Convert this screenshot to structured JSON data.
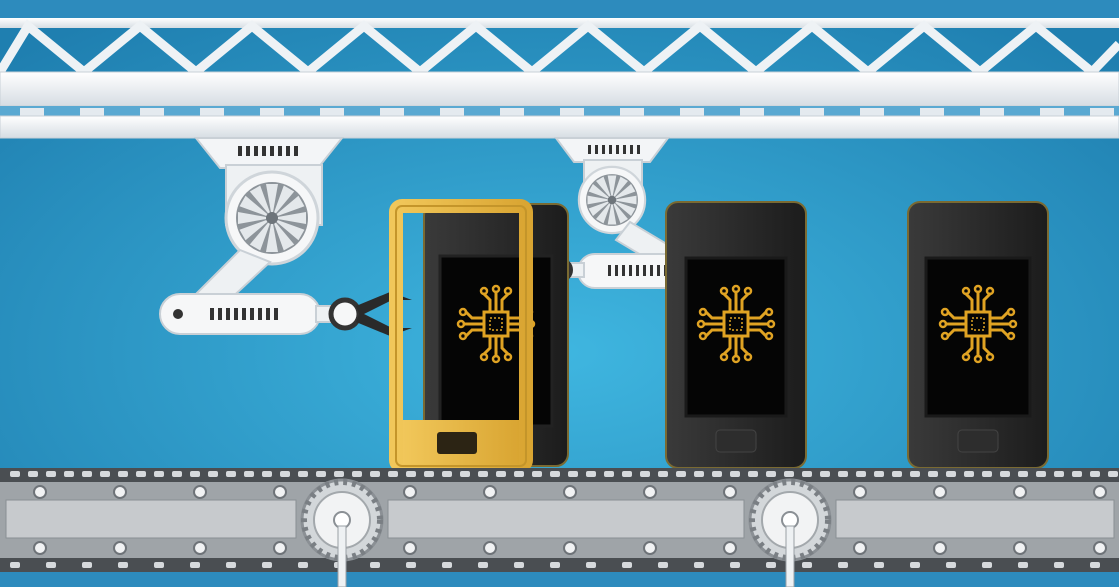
{
  "scene": {
    "description_label": "",
    "colors": {
      "background_center": "#3fb6e0",
      "background_edge": "#1f7fb0",
      "truss": "#f2f4f6",
      "truss_shadow": "#b9c3cc",
      "phone_body": "#2a2a2a",
      "phone_bezel": "#111111",
      "phone_screen": "#050505",
      "chip_gold": "#e0a323",
      "frame_gold": "#e6b843",
      "arm_white": "#eef1f3",
      "conveyor_gray": "#b8bcc0",
      "conveyor_dark": "#3a3d40"
    },
    "icons": {
      "fan": "fan-icon",
      "chip": "circuit-chip-icon",
      "gripper": "gripper-claw-icon",
      "spark": "welding-spark-icon",
      "gear": "gear-icon"
    },
    "phones": [
      {
        "id": "phone-1",
        "state": "assembly-in-progress"
      },
      {
        "id": "phone-2",
        "state": "finished"
      },
      {
        "id": "phone-3",
        "state": "finished"
      }
    ]
  }
}
